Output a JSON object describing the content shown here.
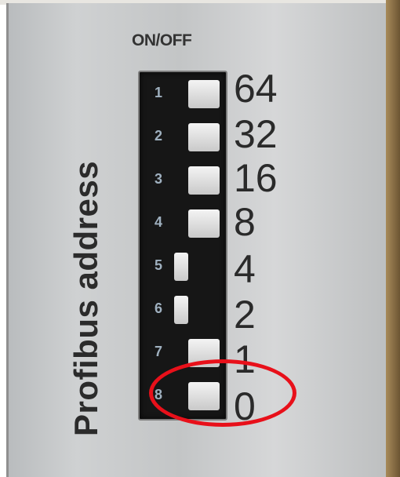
{
  "photo": {
    "header_label": "ON/OFF",
    "side_label": "Profibus address",
    "switch_numbers": [
      "1",
      "2",
      "3",
      "4",
      "5",
      "6",
      "7",
      "8"
    ],
    "switch_states": [
      "off",
      "off",
      "off",
      "off",
      "on",
      "on",
      "off",
      "off"
    ],
    "values": [
      "64",
      "32",
      "16",
      "8",
      "4",
      "2",
      "1",
      "0"
    ],
    "highlight_color": "#e8101a"
  }
}
